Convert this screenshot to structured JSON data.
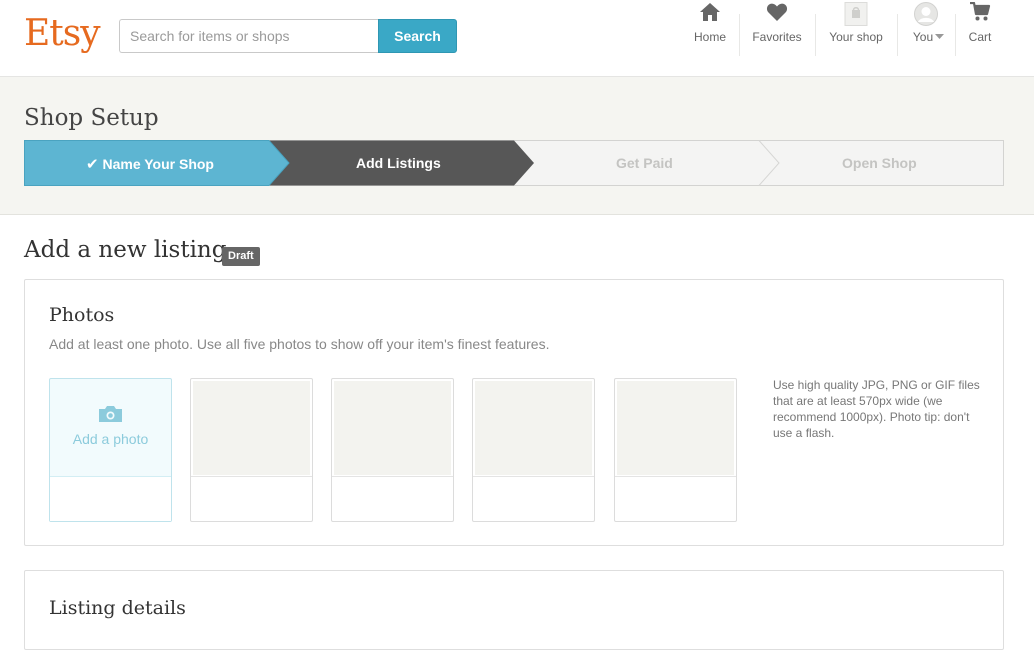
{
  "header": {
    "logo": "Etsy",
    "search_placeholder": "Search for items or shops",
    "search_button": "Search",
    "nav": [
      {
        "label": "Home",
        "icon": "home-icon"
      },
      {
        "label": "Favorites",
        "icon": "heart-icon"
      },
      {
        "label": "Your shop",
        "icon": "shop-icon"
      },
      {
        "label": "You",
        "icon": "avatar-icon"
      },
      {
        "label": "Cart",
        "icon": "cart-icon"
      }
    ]
  },
  "setup": {
    "title": "Shop Setup",
    "steps": [
      {
        "label": "Name Your Shop",
        "state": "complete"
      },
      {
        "label": "Add Listings",
        "state": "current"
      },
      {
        "label": "Get Paid",
        "state": "upcoming"
      },
      {
        "label": "Open Shop",
        "state": "upcoming"
      }
    ]
  },
  "main": {
    "title": "Add a new listing",
    "badge": "Draft",
    "photos": {
      "title": "Photos",
      "description": "Add at least one photo. Use all five photos to show off your item's finest features.",
      "add_label": "Add a photo",
      "tip": "Use high quality JPG, PNG or GIF files that are at least 570px wide (we recommend 1000px). Photo tip: don't use a flash."
    },
    "details": {
      "title": "Listing details"
    }
  },
  "colors": {
    "brand": "#e66a1f",
    "accent": "#3aa8c6",
    "step_complete": "#5bb6d2",
    "step_current": "#555555",
    "step_upcoming": "#f4f4f4"
  }
}
